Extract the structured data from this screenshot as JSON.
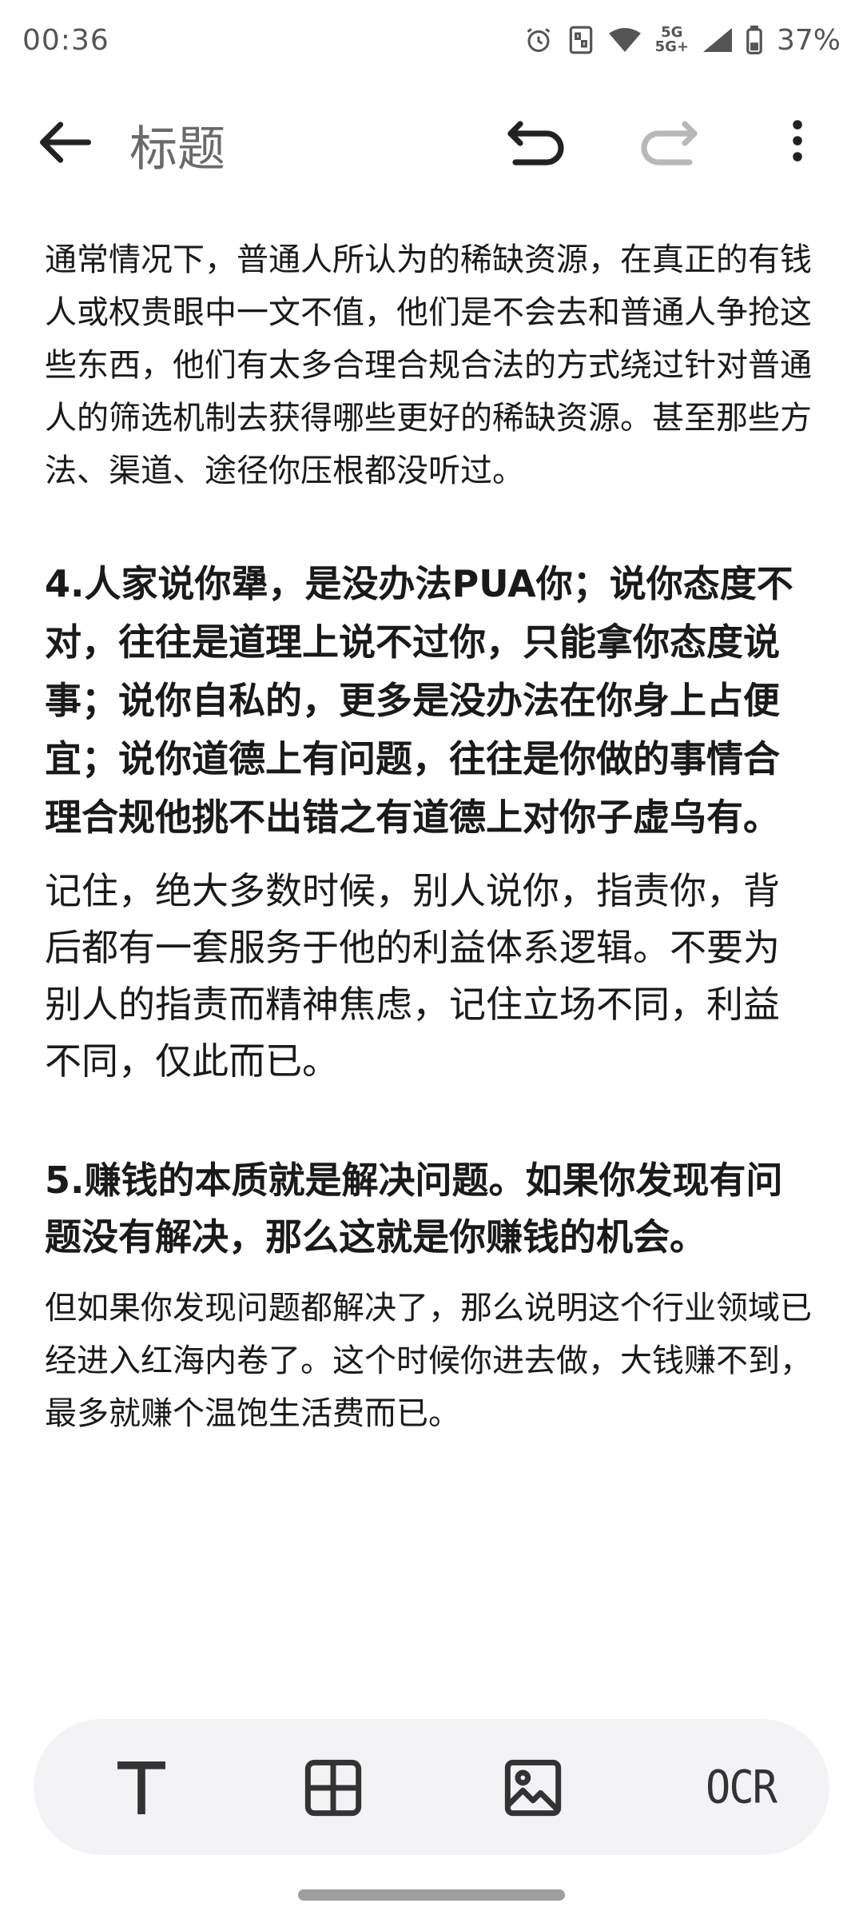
{
  "status": {
    "time": "00:36",
    "battery": "37%",
    "network_top": "5G",
    "network_bottom": "5G+"
  },
  "app_bar": {
    "title": "标题"
  },
  "content": {
    "p1": "通常情况下，普通人所认为的稀缺资源，在真正的有钱人或权贵眼中一文不值，他们是不会去和普通人争抢这些东西，他们有太多合理合规合法的方式绕过针对普通人的筛选机制去获得哪些更好的稀缺资源。甚至那些方法、渠道、途径你压根都没听过。",
    "h4": "4.人家说你犟，是没办法PUA你；说你态度不对，往往是道理上说不过你，只能拿你态度说事；说你自私的，更多是没办法在你身上占便宜；说你道德上有问题，往往是你做的事情合理合规他挑不出错之有道德上对你子虚乌有。",
    "p2": "记住，绝大多数时候，别人说你，指责你，背后都有一套服务于他的利益体系逻辑。不要为别人的指责而精神焦虑，记住立场不同，利益不同，仅此而已。",
    "h5": "5.赚钱的本质就是解决问题。如果你发现有问题没有解决，那么这就是你赚钱的机会。",
    "p3": "但如果你发现问题都解决了，那么说明这个行业领域已经进入红海内卷了。这个时候你进去做，大钱赚不到，最多就赚个温饱生活费而已。"
  },
  "toolbar": {
    "ocr_label": "OCR",
    "icons": [
      "text-format-icon",
      "table-icon",
      "image-icon",
      "ocr-icon"
    ]
  }
}
